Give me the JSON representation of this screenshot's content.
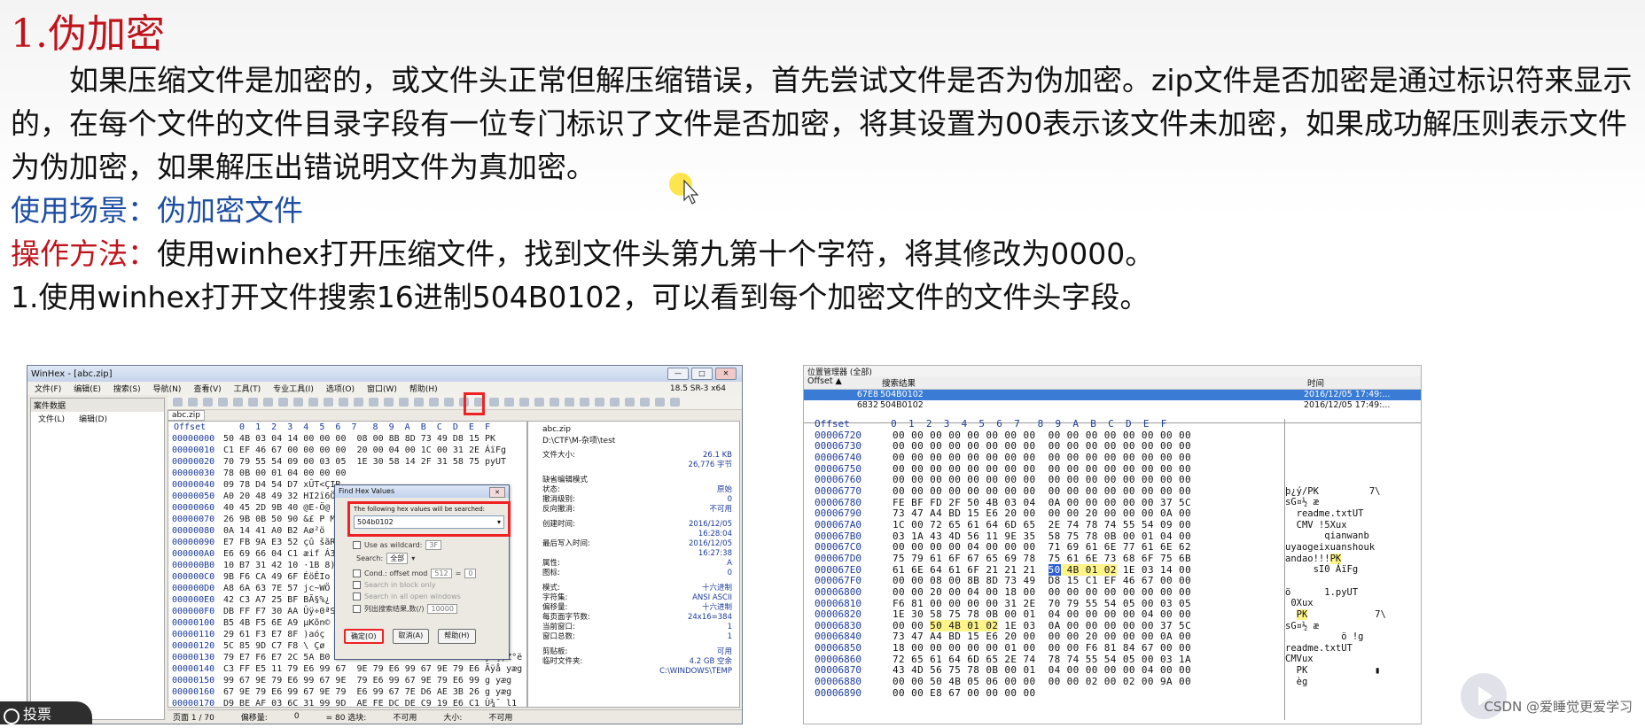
{
  "slide": {
    "title": "1.伪加密",
    "paragraph": "如果压缩文件是加密的，或文件头正常但解压缩错误，首先尝试文件是否为伪加密。zip文件是否加密是通过标识符来显示的，在每个文件的文件目录字段有一位专门标识了文件是否加密，将其设置为00表示该文件未加密，如果成功解压则表示文件为伪加密，如果解压出错说明文件为真加密。",
    "scene_label": "使用场景：",
    "scene_value": "伪加密文件",
    "method_label": "操作方法：",
    "method_value": "使用winhex打开压缩文件，找到文件头第九第十个字符，将其修改为0000。",
    "step1": "1.使用winhex打开文件搜索16进制504B0102，可以看到每个加密文件的文件头字段。",
    "watermark": "CSDN @爱睡觉更爱学习",
    "bottom_tag": "投票",
    "accent_red": "#c0141c",
    "accent_blue": "#1e4fa4"
  },
  "winhex": {
    "title": "WinHex - [abc.zip]",
    "menu": [
      "文件(F)",
      "编辑(E)",
      "搜索(S)",
      "导航(N)",
      "查看(V)",
      "工具(T)",
      "专业工具(I)",
      "选项(O)",
      "窗口(W)",
      "帮助(H)"
    ],
    "version": "18.5 SR-3 x64",
    "left_pane_header": "案件数据",
    "left_pane_menu": [
      "文件(L)",
      "编辑(D)"
    ],
    "tab": "abc.zip",
    "hex_header_offset": "Offset",
    "hex_header_cols": "  0  1  2  3  4  5  6  7   8  9  A  B  C  D  E  F",
    "rows": [
      {
        "off": "00000000",
        "hex": "50 4B 03 04 14 00 00 00  08 00 8B 8D 73 49 D8 15",
        "asc": "PK"
      },
      {
        "off": "00000010",
        "hex": "C1 EF 46 67 00 00 00 00  20 00 04 00 1C 00 31 2E",
        "asc": "ÁïFg"
      },
      {
        "off": "00000020",
        "hex": "70 79 55 54 09 00 03 05  1E 30 58 14 2F 31 58 75",
        "asc": "pyUT"
      },
      {
        "off": "00000030",
        "hex": "78 0B 00 01 04 00 00 00",
        "asc": ""
      },
      {
        "off": "00000040",
        "hex": "09 78 D4 54 D7",
        "asc": "xÛT<ÇIR"
      },
      {
        "off": "00000050",
        "hex": "A0 20 48 49 32",
        "asc": "HI2ï6Ö"
      },
      {
        "off": "00000060",
        "hex": "40 45 2D 9B 40",
        "asc": "@E-Ö@"
      },
      {
        "off": "00000070",
        "hex": "26 9B 0B 50 90",
        "asc": "&£ P Md"
      },
      {
        "off": "00000080",
        "hex": "0A 14 41 A0 B2",
        "asc": "Aø²ö"
      },
      {
        "off": "00000090",
        "hex": "E7 FB 9A E3 52",
        "asc": "çû šãR"
      },
      {
        "off": "000000A0",
        "hex": "E6 69 66 04 C1",
        "asc": "æif Á3Ìã"
      },
      {
        "off": "000000B0",
        "hex": "10 B7 31 42 10",
        "asc": "·1B 8)"
      },
      {
        "off": "000000C0",
        "hex": "9B F6 CA 49 6F",
        "asc": "ÉöÊIo"
      },
      {
        "off": "000000D0",
        "hex": "A8 6A 63 7E 57",
        "asc": "jc~WÖ"
      },
      {
        "off": "000000E0",
        "hex": "42 C3 A7 25 BF",
        "asc": "BÃ§%¿"
      },
      {
        "off": "000000F0",
        "hex": "DB FF F7 30 AA",
        "asc": "Ûÿ÷0ªSY"
      },
      {
        "off": "00000100",
        "hex": "B5 4B F5 6E A9",
        "asc": "µKõn©"
      },
      {
        "off": "00000110",
        "hex": "29 61 F3 E7 8F",
        "asc": ")aóç"
      },
      {
        "off": "00000120",
        "hex": "5C 85 9D C7 F8",
        "asc": "\\ Çø"
      },
      {
        "off": "00000130",
        "hex": "79 E7 F6 E7 2C 5A B0 EB  95 D6 C1 C6 88 02 A4 5E",
        "asc": "ýoç,Z°ë"
      },
      {
        "off": "00000140",
        "hex": "C3 FF E5 11 79 E6 99 67  9E 79 E6 99 67 9E 79 E6",
        "asc": "Ãÿå yæg"
      },
      {
        "off": "00000150",
        "hex": "99 67 9E 79 E6 99 67 9E  79 E6 99 67 9E 79 E6 99",
        "asc": "g yæg"
      },
      {
        "off": "00000160",
        "hex": "67 9E 79 E6 99 67 9E 79  E6 99 67 7E D6 AE 3B 26",
        "asc": "g yæg"
      },
      {
        "off": "00000170",
        "hex": "D9 BE AF 03 6C 31 99 9D  AE FE DC DE C9 19 E6 C1",
        "asc": "Ù¾¯ l1"
      }
    ],
    "info": {
      "filename": "abc.zip",
      "path": "D:\\CTF\\M-杂项\\test",
      "rows": [
        {
          "k": "文件大小:",
          "v": "26.1 KB"
        },
        {
          "k": "",
          "v": "26,776 字节"
        },
        {
          "k": "缺省编辑模式",
          "v": ""
        },
        {
          "k": "状态:",
          "v": "原始"
        },
        {
          "k": "撤消级别:",
          "v": "0"
        },
        {
          "k": "反向撤消:",
          "v": "不可用"
        },
        {
          "k": "创建时间:",
          "v": "2016/12/05"
        },
        {
          "k": "",
          "v": "16:28:04"
        },
        {
          "k": "最后写入时间:",
          "v": "2016/12/05"
        },
        {
          "k": "",
          "v": "16:27:38"
        },
        {
          "k": "属性:",
          "v": "A"
        },
        {
          "k": "图标:",
          "v": "0"
        },
        {
          "k": "模式:",
          "v": "十六进制"
        },
        {
          "k": "字符集:",
          "v": "ANSI ASCII"
        },
        {
          "k": "偏移量:",
          "v": "十六进制"
        },
        {
          "k": "每页面字节数:",
          "v": "24x16=384"
        },
        {
          "k": "当前窗口:",
          "v": "1"
        },
        {
          "k": "窗口总数:",
          "v": "1"
        },
        {
          "k": "剪贴板:",
          "v": "可用"
        },
        {
          "k": "临时文件夹:",
          "v": "4.2 GB 空余"
        },
        {
          "k": "",
          "v": "C:\\WINDOWS\\TEMP"
        }
      ]
    },
    "status": [
      "页面 1 / 70",
      "偏移量:",
      "0",
      "= 80 选块:",
      "不可用",
      "大小:",
      "不可用"
    ],
    "dialog": {
      "title": "Find Hex Values",
      "prompt": "The following hex values will be searched:",
      "value": "504b0102",
      "wildcard": "Use as wildcard:",
      "wildcard_val": "3F",
      "search_label": "Search:",
      "search_val": "全部",
      "cond": "Cond.: offset mod",
      "cond_a": "512",
      "cond_b": "0",
      "block": "Search in block only",
      "allwin": "Search in all open windows",
      "list": "列出搜索结果,数(/)",
      "list_val": "10000",
      "ok": "确定(O)",
      "cancel": "取消(A)",
      "help": "帮助(H)"
    }
  },
  "posmgr": {
    "title": "位置管理器 (全部)",
    "cols": [
      "Offset ▲",
      "搜索结果",
      "时间"
    ],
    "rows": [
      {
        "off": "67E8",
        "res": "504B0102",
        "time": "2016/12/05  17:49:..."
      },
      {
        "off": "6832",
        "res": "504B0102",
        "time": "2016/12/05  17:49:..."
      }
    ],
    "hex_header": "Offset       0  1  2  3  4  5  6  7   8  9  A  B  C  D  E  F",
    "rows_hex": [
      {
        "off": "00006720",
        "hex": "00 00 00 00 00 00 00 00  00 00 00 00 00 00 00 00"
      },
      {
        "off": "00006730",
        "hex": "00 00 00 00 00 00 00 00  00 00 00 00 00 00 00 00"
      },
      {
        "off": "00006740",
        "hex": "00 00 00 00 00 00 00 00  00 00 00 00 00 00 00 00"
      },
      {
        "off": "00006750",
        "hex": "00 00 00 00 00 00 00 00  00 00 00 00 00 00 00 00"
      },
      {
        "off": "00006760",
        "hex": "00 00 00 00 00 00 00 00  00 00 00 00 00 00 00 00"
      },
      {
        "off": "00006770",
        "hex": "00 00 00 00 00 00 00 00  00 00 00 00 00 00 00 00"
      },
      {
        "off": "00006780",
        "hex": "FE BF FD 2F 50 4B 03 04  0A 00 00 00 00 00 37 5C"
      },
      {
        "off": "00006790",
        "hex": "73 47 A4 BD 15 E6 20 00  00 00 20 00 00 00 0A 00"
      },
      {
        "off": "000067A0",
        "hex": "1C 00 72 65 61 64 6D 65  2E 74 78 74 55 54 09 00"
      },
      {
        "off": "000067B0",
        "hex": "03 1A 43 4D 56 11 9E 35  58 75 78 0B 00 01 04 00"
      },
      {
        "off": "000067C0",
        "hex": "00 00 00 00 04 00 00 00  71 69 61 6E 77 61 6E 62"
      },
      {
        "off": "000067D0",
        "hex": "75 79 61 6F 67 65 69 78  75 61 6E 73 68 6F 75 6B"
      },
      {
        "off": "000067E0",
        "hex": "61 6E 64 61 6F 21 21 21  50 4B 01 02 1E 03 14 00"
      },
      {
        "off": "000067F0",
        "hex": "00 00 08 00 8B 8D 73 49  D8 15 C1 EF 46 67 00 00"
      },
      {
        "off": "00006800",
        "hex": "00 00 20 00 04 00 18 00  00 00 00 00 00 00 00 00"
      },
      {
        "off": "00006810",
        "hex": "F6 81 00 00 00 00 31 2E  70 79 55 54 05 00 03 05"
      },
      {
        "off": "00006820",
        "hex": "1E 30 58 75 78 0B 00 01  04 00 00 00 00 04 00 00"
      },
      {
        "off": "00006830",
        "hex": "00 00 50 4B 01 02 1E 03  0A 00 00 00 00 00 37 5C"
      },
      {
        "off": "00006840",
        "hex": "73 47 A4 BD 15 E6 20 00  00 00 20 00 00 00 0A 00"
      },
      {
        "off": "00006850",
        "hex": "18 00 00 00 00 00 01 00  00 00 F6 81 84 67 00 00"
      },
      {
        "off": "00006860",
        "hex": "72 65 61 64 6D 65 2E 74  78 74 55 54 05 00 03 1A"
      },
      {
        "off": "00006870",
        "hex": "43 4D 56 75 78 0B 00 01  04 00 00 00 00 04 00 00"
      },
      {
        "off": "00006880",
        "hex": "00 00 50 4B 05 06 00 00  00 00 02 00 02 00 9A 00"
      },
      {
        "off": "00006890",
        "hex": "00 00 E8 67 00 00 00 00"
      }
    ],
    "ascii": [
      "",
      "",
      "",
      "",
      "",
      "",
      "þ¿ý/PK         7\\",
      "sG¤½ æ",
      "  readme.txtUT",
      "  CMV !5Xux",
      "       qianwanb",
      "uyaogeixuanshouk",
      "andao!!!PK",
      "     sI0 ÁïFg",
      "",
      "ö      1.pyUT",
      " 0Xux",
      "  PK            7\\",
      "sG¤½ æ",
      "          ö !g",
      "readme.txtUT",
      "CMVux",
      "  PK            ▮",
      "  èg"
    ]
  }
}
